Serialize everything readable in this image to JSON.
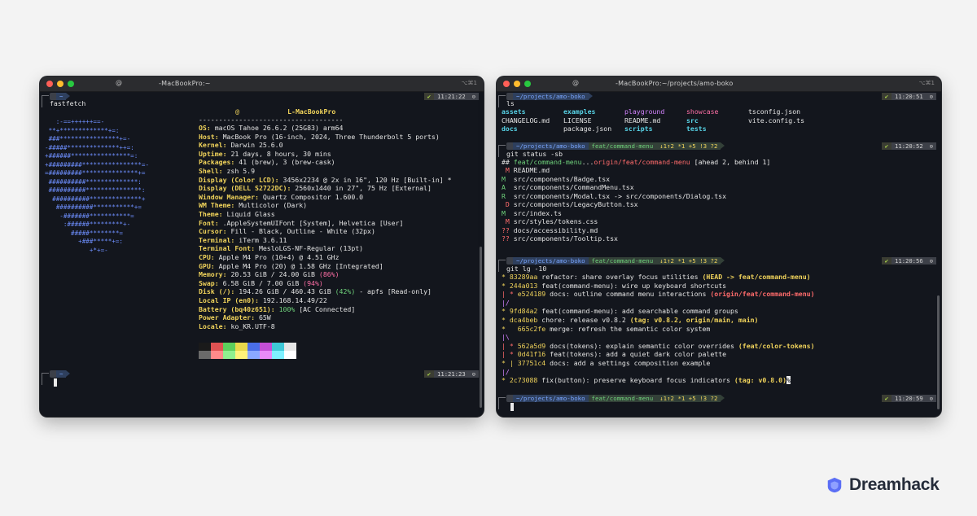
{
  "left_window": {
    "icon": "@",
    "title": "-MacBookPro:~",
    "shortcut": "⌥⌘1",
    "prompt_top": {
      "os": "",
      "dir": "~",
      "ok": "✔",
      "time": "11:21:22",
      "clock": "⊙"
    },
    "command": "fastfetch",
    "header_user": "@",
    "header_host": "L-MacBookPro",
    "separator": "------------------------------------",
    "info": [
      {
        "key": "OS:",
        "val": "macOS Tahoe 26.6.2 (25G83) arm64"
      },
      {
        "key": "Host:",
        "val": "MacBook Pro (16-inch, 2024, Three Thunderbolt 5 ports)"
      },
      {
        "key": "Kernel:",
        "val": "Darwin 25.6.0"
      },
      {
        "key": "Uptime:",
        "val": "21 days, 8 hours, 30 mins"
      },
      {
        "key": "Packages:",
        "val": "41 (brew), 3 (brew-cask)"
      },
      {
        "key": "Shell:",
        "val": "zsh 5.9"
      },
      {
        "key": "Display (Color LCD):",
        "val": "3456x2234 @ 2x in 16\", 120 Hz [Built-in] *"
      },
      {
        "key": "Display (DELL S2722DC):",
        "val": "2560x1440 in 27\", 75 Hz [External]"
      },
      {
        "key": "Window Manager:",
        "val": "Quartz Compositor 1.600.0"
      },
      {
        "key": "WM Theme:",
        "val": "Multicolor (Dark)"
      },
      {
        "key": "Theme:",
        "val": "Liquid Glass"
      },
      {
        "key": "Font:",
        "val": ".AppleSystemUIFont [System], Helvetica [User]"
      },
      {
        "key": "Cursor:",
        "val": "Fill - Black, Outline - White (32px)"
      },
      {
        "key": "Terminal:",
        "val": "iTerm 3.6.11"
      },
      {
        "key": "Terminal Font:",
        "val": "MesloLGS-NF-Regular (13pt)"
      },
      {
        "key": "CPU:",
        "val": "Apple M4 Pro (10+4) @ 4.51 GHz"
      },
      {
        "key": "GPU:",
        "val": "Apple M4 Pro (20) @ 1.58 GHz [Integrated]"
      },
      {
        "key": "Memory:",
        "val": "20.53 GiB / 24.00 GiB",
        "pct": "(86%)",
        "pct_color": "pink"
      },
      {
        "key": "Swap:",
        "val": "6.58 GiB / 7.00 GiB",
        "pct": "(94%)",
        "pct_color": "pink"
      },
      {
        "key": "Disk (/):",
        "val": "194.26 GiB / 460.43 GiB",
        "pct": "(42%)",
        "pct_color": "grn",
        "tail": " - apfs [Read-only]"
      },
      {
        "key": "Local IP (en0):",
        "val": "192.168.14.49/22"
      },
      {
        "key": "Battery (bq40z651):",
        "val": "",
        "pct": "100%",
        "pct_color": "grn",
        "tail": " [AC Connected]"
      },
      {
        "key": "Power Adapter:",
        "val": "65W"
      },
      {
        "key": "Locale:",
        "val": "ko_KR.UTF-8"
      }
    ],
    "logo_lines": [
      "   :-==++++++==-",
      " **+*************+=:",
      " ###****************+=-",
      "-#####**************++=:",
      "+######****************=:",
      "+#########****************=-",
      "=#########***************+=",
      " ##########**************:",
      " ##########***************:",
      "  ##########**************+",
      "   ##########***********+=",
      "    -#######***********=",
      "     :######*********+-",
      "       #####********=",
      "         +###*****+=:",
      "            +*+=-"
    ],
    "palette_top": [
      "#1a1a1a",
      "#e05252",
      "#5ccf5c",
      "#e8d84a",
      "#4a6ee8",
      "#c44fd6",
      "#3fc9d8",
      "#e6e6e6"
    ],
    "palette_bottom": [
      "#6a6a6a",
      "#ff8a8a",
      "#8ff08f",
      "#fff27a",
      "#8aa8ff",
      "#e98af8",
      "#7ff0ff",
      "#ffffff"
    ],
    "prompt_bottom": {
      "os": "",
      "dir": "~",
      "ok": "✔",
      "time": "11:21:23",
      "clock": "⊙"
    }
  },
  "right_window": {
    "icon": "@",
    "title": "-MacBookPro:~/projects/amo-boko",
    "shortcut": "⌥⌘1",
    "p1": {
      "dir": "~/projects/amo-boko",
      "time": "11:20:51"
    },
    "cmd1": "ls",
    "ls_rows": [
      [
        {
          "t": "assets",
          "c": "cyan",
          "b": true
        },
        {
          "t": "examples",
          "c": "cyan",
          "b": true
        },
        {
          "t": "playground",
          "c": "mag"
        },
        {
          "t": "showcase",
          "c": "pink"
        },
        {
          "t": "tsconfig.json",
          "c": ""
        }
      ],
      [
        {
          "t": "CHANGELOG.md",
          "c": ""
        },
        {
          "t": "LICENSE",
          "c": ""
        },
        {
          "t": "README.md",
          "c": ""
        },
        {
          "t": "src",
          "c": "cyan",
          "b": true
        },
        {
          "t": "vite.config.ts",
          "c": ""
        }
      ],
      [
        {
          "t": "docs",
          "c": "cyan",
          "b": true
        },
        {
          "t": "package.json",
          "c": ""
        },
        {
          "t": "scripts",
          "c": "cyan",
          "b": true
        },
        {
          "t": "tests",
          "c": "cyan",
          "b": true
        },
        {
          "t": "",
          "c": ""
        }
      ]
    ],
    "p2": {
      "dir": "~/projects/amo-boko",
      "branch": "feat/command-menu",
      "counts": "↓1↑2 *1 +5 !3 ?2",
      "time": "11:20:52"
    },
    "cmd2": "git status -sb",
    "status_header": {
      "prefix": "## ",
      "local": "feat/command-menu",
      "dots": "...",
      "remote": "origin/feat/command-menu",
      "tail": " [ahead 2, behind 1]"
    },
    "status_lines": [
      {
        "code": " M",
        "code_color": "red",
        "path": "README.md"
      },
      {
        "code": "M ",
        "code_color": "grn",
        "path": "src/components/Badge.tsx"
      },
      {
        "code": "A ",
        "code_color": "grn",
        "path": "src/components/CommandMenu.tsx"
      },
      {
        "code": "R ",
        "code_color": "grn",
        "path": "src/components/Modal.tsx -> src/components/Dialog.tsx"
      },
      {
        "code": " D",
        "code_color": "red",
        "path": "src/components/LegacyButton.tsx"
      },
      {
        "code": "M ",
        "code_color": "grn",
        "path": "src/index.ts"
      },
      {
        "code": " M",
        "code_color": "red",
        "path": "src/styles/tokens.css"
      },
      {
        "code": "??",
        "code_color": "red",
        "path": "docs/accessibility.md"
      },
      {
        "code": "??",
        "code_color": "red",
        "path": "src/components/Tooltip.tsx"
      }
    ],
    "p3": {
      "dir": "~/projects/amo-boko",
      "branch": "feat/command-menu",
      "counts": "↓1↑2 *1 +5 !3 ?2",
      "time": "11:20:56"
    },
    "cmd3": "git lg -10",
    "log_lines": [
      {
        "graph": "* ",
        "hash": "83289aa",
        "msg": " refactor: share overlay focus utilities ",
        "ref": "(HEAD -> feat/command-menu)",
        "ref_color": "ylw"
      },
      {
        "graph": "* ",
        "hash": "244a013",
        "msg": " feat(command-menu): wire up keyboard shortcuts",
        "ref": "",
        "ref_color": ""
      },
      {
        "graph": "| * ",
        "hash": "e524189",
        "msg": " docs: outline command menu interactions ",
        "ref": "(origin/feat/command-menu)",
        "ref_color": "red"
      },
      {
        "graph": "|/",
        "hash": "",
        "msg": "",
        "ref": "",
        "ref_color": ""
      },
      {
        "graph": "* ",
        "hash": "9fd84a2",
        "msg": " feat(command-menu): add searchable command groups",
        "ref": "",
        "ref_color": ""
      },
      {
        "graph": "* ",
        "hash": "dca4beb",
        "msg": " chore: release v0.8.2 ",
        "ref": "(tag: v0.8.2, origin/main, main)",
        "ref_color": "ylw"
      },
      {
        "graph": "*   ",
        "hash": "665c2fe",
        "msg": " merge: refresh the semantic color system",
        "ref": "",
        "ref_color": ""
      },
      {
        "graph": "|\\",
        "hash": "",
        "msg": "",
        "ref": "",
        "ref_color": ""
      },
      {
        "graph": "| * ",
        "hash": "562a5d9",
        "msg": " docs(tokens): explain semantic color overrides ",
        "ref": "(feat/color-tokens)",
        "ref_color": "ylw"
      },
      {
        "graph": "| * ",
        "hash": "0d41f16",
        "msg": " feat(tokens): add a quiet dark color palette",
        "ref": "",
        "ref_color": ""
      },
      {
        "graph": "* | ",
        "hash": "37751c4",
        "msg": " docs: add a settings composition example",
        "ref": "",
        "ref_color": ""
      },
      {
        "graph": "|/",
        "hash": "",
        "msg": "",
        "ref": "",
        "ref_color": ""
      },
      {
        "graph": "* ",
        "hash": "2c73088",
        "msg": " fix(button): preserve keyboard focus indicators ",
        "ref": "(tag: v0.8.0)",
        "ref_color": "ylw"
      }
    ],
    "percent_mark": "%",
    "p4": {
      "dir": "~/projects/amo-boko",
      "branch": "feat/command-menu",
      "counts": "↓1↑2 *1 +5 !3 ?2",
      "time": "11:20:59"
    }
  },
  "brand": {
    "name": "Dreamhack",
    "color": "#5b6ef5"
  }
}
